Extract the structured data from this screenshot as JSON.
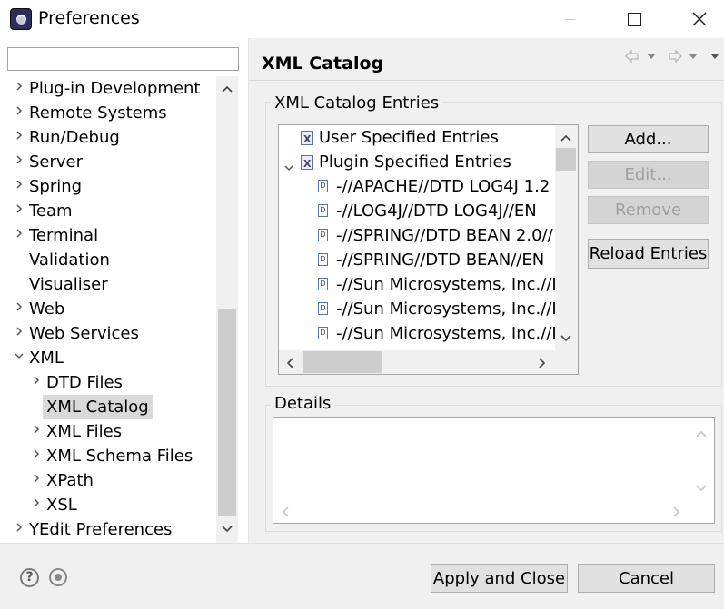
{
  "window": {
    "title": "Preferences",
    "icons": {
      "app": "eclipse-icon",
      "minimize": "minimize-icon",
      "maximize": "maximize-icon",
      "close": "close-icon"
    }
  },
  "sidebar": {
    "filter_value": "",
    "items": [
      {
        "label": "Plug-in Development",
        "level": 0,
        "arrow": "›",
        "selected": false
      },
      {
        "label": "Remote Systems",
        "level": 0,
        "arrow": "›",
        "selected": false
      },
      {
        "label": "Run/Debug",
        "level": 0,
        "arrow": "›",
        "selected": false
      },
      {
        "label": "Server",
        "level": 0,
        "arrow": "›",
        "selected": false
      },
      {
        "label": "Spring",
        "level": 0,
        "arrow": "›",
        "selected": false
      },
      {
        "label": "Team",
        "level": 0,
        "arrow": "›",
        "selected": false
      },
      {
        "label": "Terminal",
        "level": 0,
        "arrow": "›",
        "selected": false
      },
      {
        "label": "Validation",
        "level": 0,
        "arrow": "",
        "selected": false
      },
      {
        "label": "Visualiser",
        "level": 0,
        "arrow": "",
        "selected": false
      },
      {
        "label": "Web",
        "level": 0,
        "arrow": "›",
        "selected": false
      },
      {
        "label": "Web Services",
        "level": 0,
        "arrow": "›",
        "selected": false
      },
      {
        "label": "XML",
        "level": 0,
        "arrow": "⌄",
        "selected": false
      },
      {
        "label": "DTD Files",
        "level": 1,
        "arrow": "›",
        "selected": false
      },
      {
        "label": "XML Catalog",
        "level": 1,
        "arrow": "",
        "selected": true
      },
      {
        "label": "XML Files",
        "level": 1,
        "arrow": "›",
        "selected": false
      },
      {
        "label": "XML Schema Files",
        "level": 1,
        "arrow": "›",
        "selected": false
      },
      {
        "label": "XPath",
        "level": 1,
        "arrow": "›",
        "selected": false
      },
      {
        "label": "XSL",
        "level": 1,
        "arrow": "›",
        "selected": false
      },
      {
        "label": "YEdit Preferences",
        "level": 0,
        "arrow": "›",
        "selected": false
      }
    ]
  },
  "main": {
    "page_title": "XML Catalog",
    "entries_group_label": "XML Catalog Entries",
    "entries": [
      {
        "label": "User Specified Entries",
        "level": 0,
        "arrow": "",
        "icon": "catalog-icon"
      },
      {
        "label": "Plugin Specified Entries",
        "level": 0,
        "arrow": "⌄",
        "icon": "catalog-icon"
      },
      {
        "label": "-//APACHE//DTD LOG4J 1.2",
        "level": 1,
        "arrow": "",
        "icon": "dtd-file-icon"
      },
      {
        "label": "-//LOG4J//DTD LOG4J//EN",
        "level": 1,
        "arrow": "",
        "icon": "dtd-file-icon"
      },
      {
        "label": "-//SPRING//DTD BEAN 2.0//",
        "level": 1,
        "arrow": "",
        "icon": "dtd-file-icon"
      },
      {
        "label": "-//SPRING//DTD BEAN//EN",
        "level": 1,
        "arrow": "",
        "icon": "dtd-file-icon"
      },
      {
        "label": "-//Sun Microsystems, Inc.//D",
        "level": 1,
        "arrow": "",
        "icon": "dtd-file-icon"
      },
      {
        "label": "-//Sun Microsystems, Inc.//D",
        "level": 1,
        "arrow": "",
        "icon": "dtd-file-icon"
      },
      {
        "label": "-//Sun Microsystems, Inc.//D",
        "level": 1,
        "arrow": "",
        "icon": "dtd-file-icon"
      }
    ],
    "buttons": {
      "add": "Add...",
      "edit": "Edit...",
      "remove": "Remove",
      "reload": "Reload Entries"
    },
    "details_group_label": "Details",
    "details_value": ""
  },
  "footer": {
    "apply_close": "Apply and Close",
    "cancel": "Cancel"
  }
}
